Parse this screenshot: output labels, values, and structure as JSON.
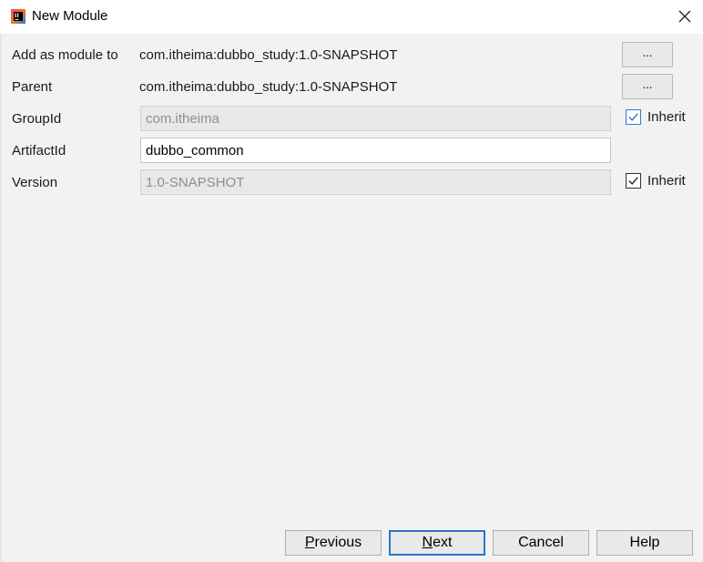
{
  "window": {
    "title": "New Module",
    "icon": "intellij-idea-icon",
    "close_icon": "close-icon"
  },
  "form": {
    "add_as_module_to": {
      "label": "Add as module to",
      "value": "com.itheima:dubbo_study:1.0-SNAPSHOT",
      "button_label": "..."
    },
    "parent": {
      "label": "Parent",
      "value": "com.itheima:dubbo_study:1.0-SNAPSHOT",
      "button_label": "..."
    },
    "group_id": {
      "label": "GroupId",
      "value": "com.itheima",
      "inherit_label": "Inherit",
      "inherit_checked": true
    },
    "artifact_id": {
      "label": "ArtifactId",
      "value": "dubbo_common"
    },
    "version": {
      "label": "Version",
      "value": "1.0-SNAPSHOT",
      "inherit_label": "Inherit",
      "inherit_checked": true
    }
  },
  "footer": {
    "previous": {
      "mnemonic": "P",
      "rest": "revious"
    },
    "next": {
      "mnemonic": "N",
      "rest": "ext"
    },
    "cancel_label": "Cancel",
    "help_label": "Help"
  },
  "colors": {
    "background": "#f2f2f2",
    "focus_accent": "#2a74c9",
    "disabled_text": "#8e8e8e"
  }
}
